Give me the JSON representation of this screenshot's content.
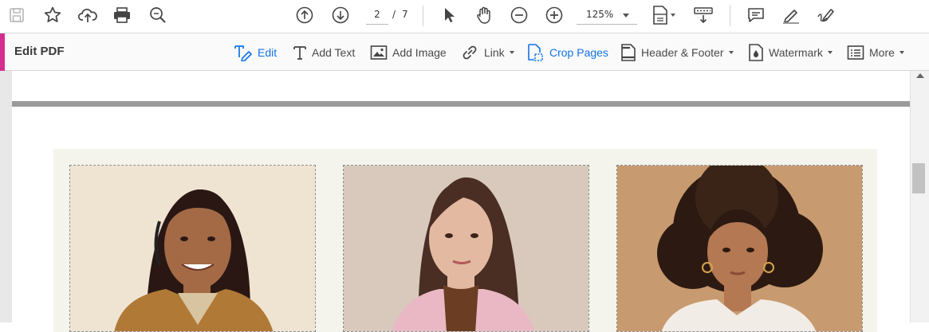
{
  "toolbar": {
    "icons": [
      "save-icon",
      "bookmark-star-icon",
      "upload-cloud-icon",
      "print-icon",
      "zoom-search-icon",
      "prev-page-icon",
      "next-page-icon",
      "select-arrow-icon",
      "hand-pan-icon",
      "zoom-out-icon",
      "zoom-in-icon",
      "page-fit-icon",
      "keyboard-scroll-icon",
      "comment-icon",
      "highlight-pen-icon",
      "sign-icon"
    ],
    "current_page": "2",
    "page_separator": "/",
    "total_pages": "7",
    "zoom": "125%"
  },
  "edit_bar": {
    "title": "Edit PDF",
    "accent_color": "#d62e8f",
    "tools": [
      {
        "label": "Edit",
        "icon": "edit-text-icon",
        "active": true
      },
      {
        "label": "Add Text",
        "icon": "text-t-icon",
        "active": false
      },
      {
        "label": "Add Image",
        "icon": "image-icon",
        "active": false
      },
      {
        "label": "Link",
        "icon": "link-icon",
        "active": false
      },
      {
        "label": "Crop Pages",
        "icon": "crop-icon",
        "active": true
      },
      {
        "label": "Header & Footer",
        "icon": "document-icon",
        "active": false
      },
      {
        "label": "Watermark",
        "icon": "watermark-icon",
        "active": false
      },
      {
        "label": "More",
        "icon": "more-list-icon",
        "active": false
      }
    ],
    "active_color": "#1473e6"
  },
  "document": {
    "photos": [
      {
        "name": "portrait-1",
        "bg": "#efe4d2",
        "skin": "#a36a45",
        "hair": "#2a1714",
        "clothing": "#b07a36"
      },
      {
        "name": "portrait-2",
        "bg": "#d8c9bc",
        "skin": "#e3b9a1",
        "hair": "#4a2e24",
        "clothing": "#eab8c5"
      },
      {
        "name": "portrait-3",
        "bg": "#c89a6f",
        "skin": "#b47852",
        "hair": "#2c1a12",
        "clothing": "#f2ece6"
      }
    ]
  }
}
